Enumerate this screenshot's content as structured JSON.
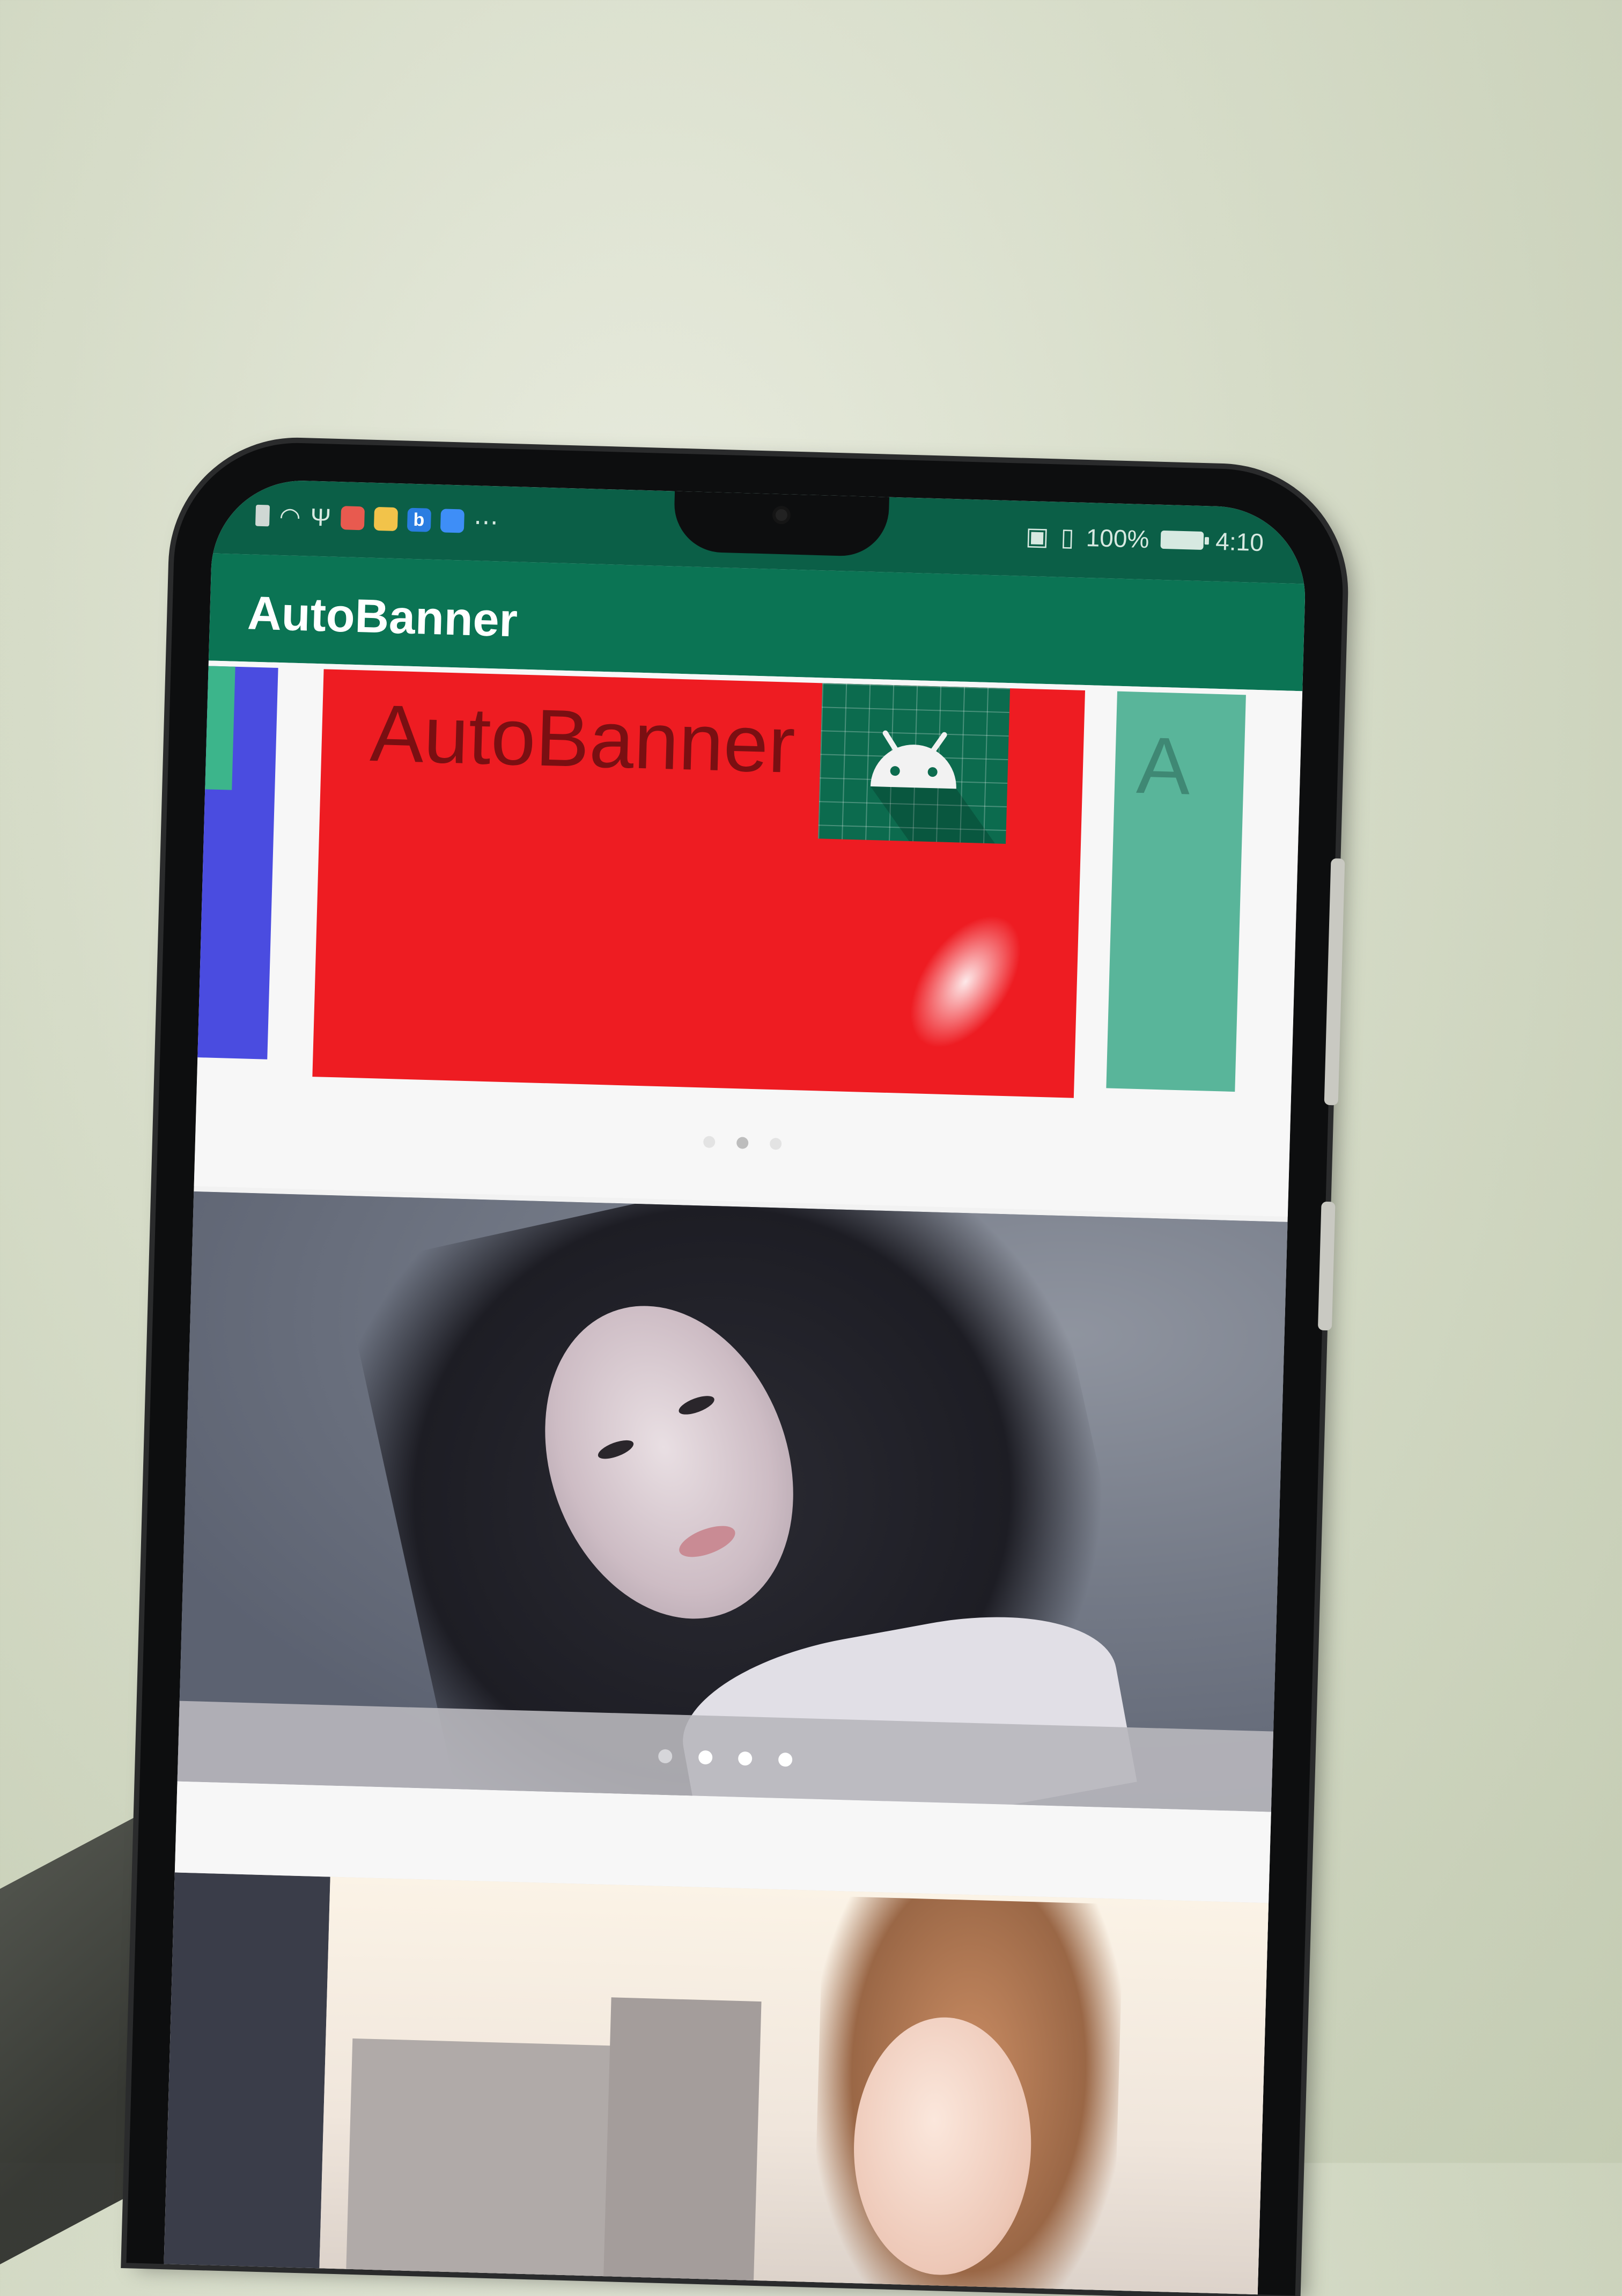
{
  "status_bar": {
    "battery_text": "100%",
    "time": "4:10"
  },
  "app_bar": {
    "title": "AutoBanner"
  },
  "banner_1": {
    "current_slide_text": "AutoBanner",
    "next_slide_peek": "A",
    "indicator_count": 3,
    "active_indicator": 2,
    "slide_color": "#ee1c22"
  },
  "banner_2": {
    "indicator_count": 4,
    "active_indicator": 1
  },
  "colors": {
    "status_bar": "#0b5f47",
    "app_bar": "#0b7454"
  }
}
